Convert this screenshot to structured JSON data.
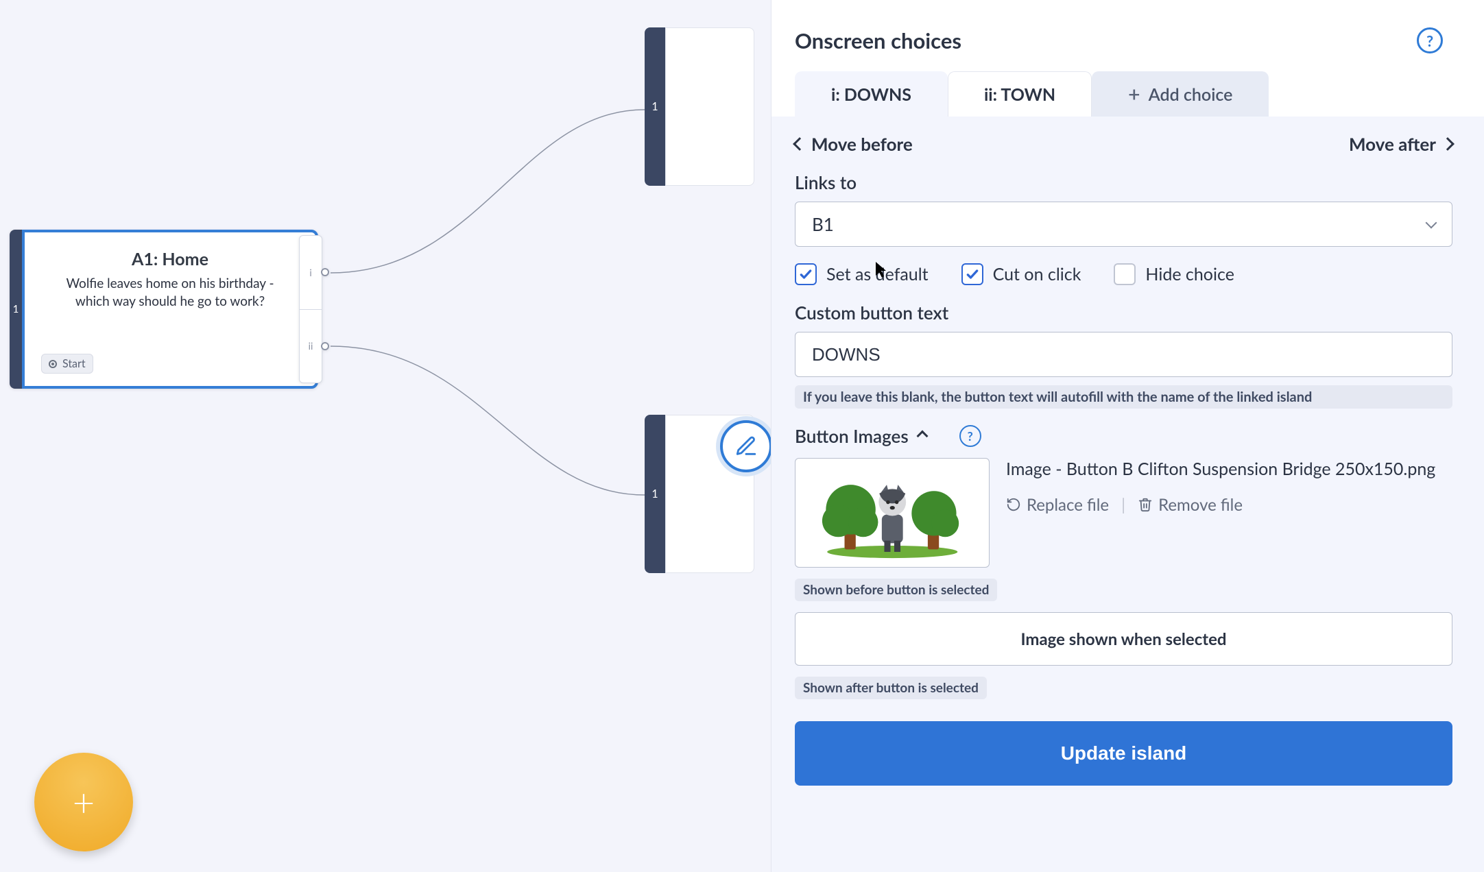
{
  "canvas": {
    "island": {
      "number": "1",
      "title": "A1: Home",
      "description": "Wolfie leaves home on his birthday - which way should he go to work?",
      "start_label": "Start"
    },
    "outlets": [
      "i",
      "ii"
    ],
    "targets": [
      {
        "number": "1"
      },
      {
        "number": "1"
      }
    ]
  },
  "sidebar": {
    "title": "Onscreen choices",
    "tabs": [
      {
        "label": "i: DOWNS",
        "active": true
      },
      {
        "label": "ii: TOWN",
        "active": false
      }
    ],
    "add_choice_label": "Add choice",
    "move_before": "Move before",
    "move_after": "Move after",
    "links_to_label": "Links to",
    "links_to_value": "B1",
    "checkboxes": {
      "set_default": {
        "label": "Set as default",
        "checked": true
      },
      "cut_on_click": {
        "label": "Cut on click",
        "checked": true
      },
      "hide_choice": {
        "label": "Hide choice",
        "checked": false
      }
    },
    "custom_button_label": "Custom button text",
    "custom_button_value": "DOWNS",
    "custom_button_hint": "If you leave this blank, the button text will autofill with the name of the linked island",
    "button_images_label": "Button Images",
    "image_filename": "Image - Button B Clifton Suspension Bridge 250x150.png",
    "replace_file": "Replace file",
    "remove_file": "Remove file",
    "shown_before": "Shown before button is selected",
    "selected_placeholder": "Image shown when selected",
    "shown_after": "Shown after button is selected",
    "update_label": "Update island"
  }
}
